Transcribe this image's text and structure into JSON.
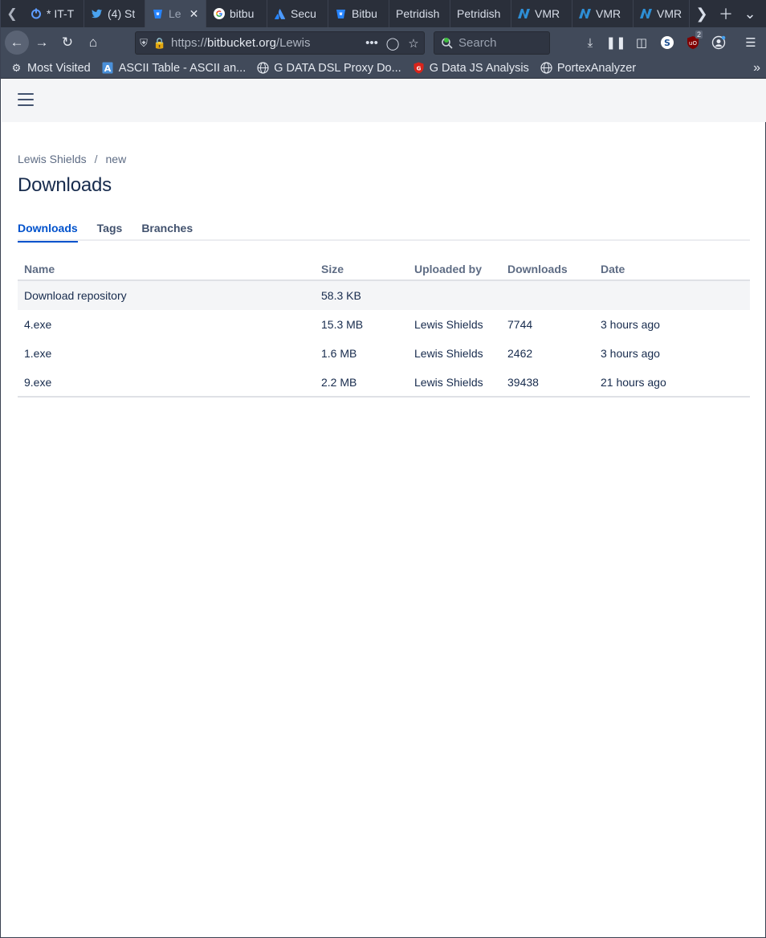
{
  "browser": {
    "tabs": [
      {
        "title": "* IT-T",
        "icon": "power-icon"
      },
      {
        "title": "(4) St",
        "icon": "twitter-icon"
      },
      {
        "title": "Le",
        "icon": "bitbucket-icon",
        "active": true
      },
      {
        "title": "bitbu",
        "icon": "google-icon"
      },
      {
        "title": "Secu",
        "icon": "atlassian-icon"
      },
      {
        "title": "Bitbu",
        "icon": "bitbucket-icon"
      },
      {
        "title": "Petridish",
        "icon": ""
      },
      {
        "title": "Petridish",
        "icon": ""
      },
      {
        "title": "VMR",
        "icon": "vmray-icon"
      },
      {
        "title": "VMR",
        "icon": "vmray-icon"
      },
      {
        "title": "VMR",
        "icon": "vmray-icon"
      }
    ],
    "url_prefix": "https://",
    "url_host": "bitbucket.org",
    "url_rest": "/Lewis",
    "search_placeholder": "Search",
    "ublock_count": "2",
    "bookmarks": [
      {
        "label": "Most Visited",
        "icon": "gear-icon"
      },
      {
        "label": "ASCII Table - ASCII an...",
        "icon": "ascii-icon"
      },
      {
        "label": "G DATA DSL Proxy Do...",
        "icon": "globe-icon"
      },
      {
        "label": "G Data JS Analysis",
        "icon": "shield-icon"
      },
      {
        "label": "PortexAnalyzer",
        "icon": "globe-icon"
      }
    ]
  },
  "page": {
    "breadcrumb": [
      "Lewis Shields",
      "new"
    ],
    "title": "Downloads",
    "tabs": [
      "Downloads",
      "Tags",
      "Branches"
    ],
    "active_tab": "Downloads",
    "table": {
      "headers": [
        "Name",
        "Size",
        "Uploaded by",
        "Downloads",
        "Date"
      ],
      "rows": [
        {
          "name": "Download repository",
          "size": "58.3 KB",
          "uploaded_by": "",
          "downloads": "",
          "date": ""
        },
        {
          "name": "4.exe",
          "size": "15.3 MB",
          "uploaded_by": "Lewis Shields",
          "downloads": "7744",
          "date": "3 hours ago"
        },
        {
          "name": "1.exe",
          "size": "1.6 MB",
          "uploaded_by": "Lewis Shields",
          "downloads": "2462",
          "date": "3 hours ago"
        },
        {
          "name": "9.exe",
          "size": "2.2 MB",
          "uploaded_by": "Lewis Shields",
          "downloads": "39438",
          "date": "21 hours ago"
        }
      ]
    }
  },
  "colors": {
    "accent": "#0052cc",
    "heading": "#172b4d",
    "subtle": "#5e6c84",
    "chrome_dark": "#2a2f3a",
    "chrome": "#414a5a"
  }
}
